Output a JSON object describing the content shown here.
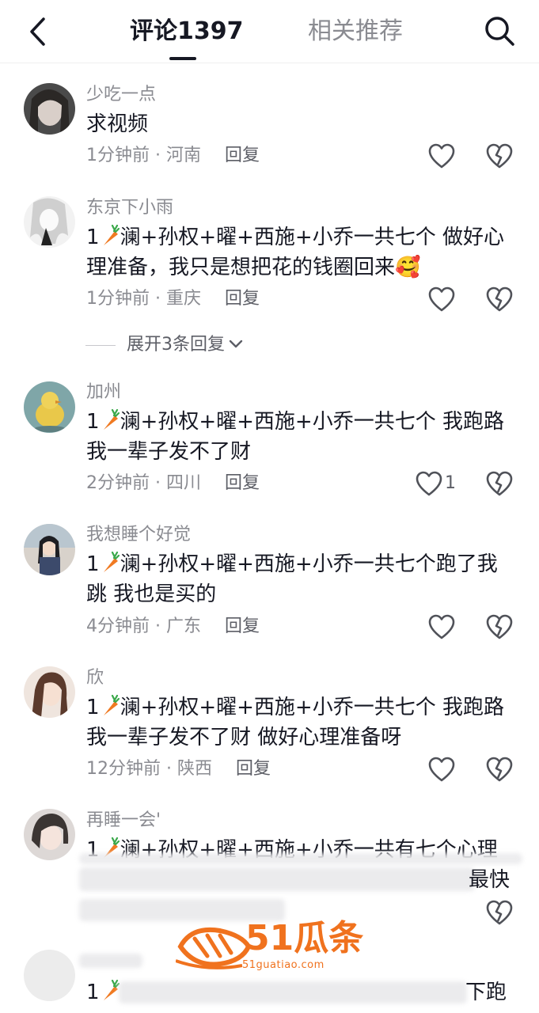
{
  "header": {
    "tab_comments": "评论1397",
    "tab_related": "相关推荐"
  },
  "comments": [
    {
      "username": "少吃一点",
      "text": "求视频",
      "time": "1分钟前",
      "location": "河南",
      "reply": "回复",
      "likes": ""
    },
    {
      "username": "东京下小雨",
      "text_parts": [
        "1",
        "澜+孙权+曜+西施+小乔一共七个 做好心理准备，我只是想把花的钱圈回来"
      ],
      "emoji": "🥰",
      "time": "1分钟前",
      "location": "重庆",
      "reply": "回复",
      "likes": "",
      "expand_label": "展开3条回复"
    },
    {
      "username": "加州",
      "text_parts": [
        "1",
        "澜+孙权+曜+西施+小乔一共七个 我跑路我一辈子发不了财"
      ],
      "time": "2分钟前",
      "location": "四川",
      "reply": "回复",
      "likes": "1"
    },
    {
      "username": "我想睡个好觉",
      "text_parts": [
        "1",
        "澜+孙权+曜+西施+小乔一共七个跑了我跳  我也是买的"
      ],
      "time": "4分钟前",
      "location": "广东",
      "reply": "回复",
      "likes": ""
    },
    {
      "username": "欣",
      "text_parts": [
        "1",
        "澜+孙权+曜+西施+小乔一共七个 我跑路我一辈子发不了财 做好心理准备呀"
      ],
      "time": "12分钟前",
      "location": "陕西",
      "reply": "回复",
      "likes": ""
    },
    {
      "username": "再睡一会'",
      "text_parts": [
        "1",
        "澜+孙权+曜+西施+小乔一共有七个心理"
      ],
      "tail_text": "最快",
      "time": "",
      "location": "",
      "reply": "",
      "likes": ""
    },
    {
      "username": "",
      "text_parts": [
        "1",
        ""
      ],
      "tail_text": "下跑",
      "time": "",
      "location": "",
      "reply": "",
      "likes": ""
    }
  ],
  "separator": " · ",
  "watermark": {
    "brand": "51瓜条",
    "url": "51guatiao.com"
  },
  "icons": [
    "back-arrow-icon",
    "search-icon",
    "heart-icon",
    "broken-heart-icon",
    "chevron-down-icon",
    "carrot-emoji-icon"
  ],
  "colors": {
    "primary_text": "#161823",
    "secondary_text": "#8a8b91",
    "watermark": "#f0721e"
  }
}
